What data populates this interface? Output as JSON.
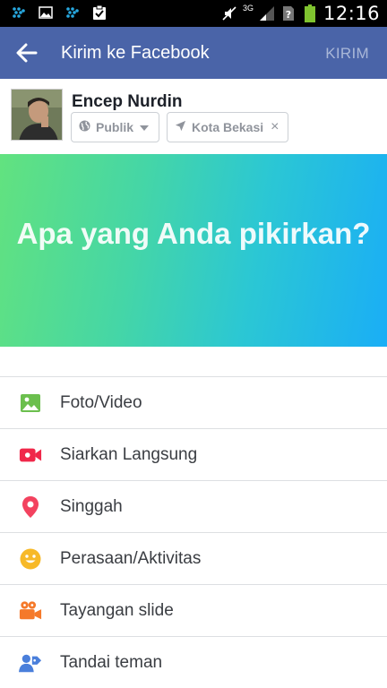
{
  "status_bar": {
    "time": "12:16",
    "network_label": "3G",
    "icons": [
      "blackberry-icon",
      "image-notification-icon",
      "blackberry-icon",
      "clipboard-check-icon",
      "mute-icon",
      "signal-icon",
      "no-sim-icon",
      "battery-icon"
    ]
  },
  "app_bar": {
    "title": "Kirim ke Facebook",
    "post_label": "KIRIM"
  },
  "user": {
    "name": "Encep Nurdin",
    "privacy_label": "Publik",
    "location_label": "Kota Bekasi",
    "location_clear": "×"
  },
  "composer": {
    "prompt": "Apa yang Anda pikirkan?"
  },
  "options": [
    {
      "label": "Foto/Video",
      "icon": "photo-icon",
      "color": "#6bbf4e"
    },
    {
      "label": "Siarkan Langsung",
      "icon": "live-video-icon",
      "color": "#f0284a"
    },
    {
      "label": "Singgah",
      "icon": "location-pin-icon",
      "color": "#f3425f"
    },
    {
      "label": "Perasaan/Aktivitas",
      "icon": "smiley-icon",
      "color": "#f7b928"
    },
    {
      "label": "Tayangan slide",
      "icon": "slideshow-camera-icon",
      "color": "#f5792a"
    },
    {
      "label": "Tandai teman",
      "icon": "tag-friend-icon",
      "color": "#4a7fdb"
    }
  ],
  "colors": {
    "app_bar": "#4a64a8",
    "gradient_start": "#62e27f",
    "gradient_end": "#1aaef6"
  }
}
